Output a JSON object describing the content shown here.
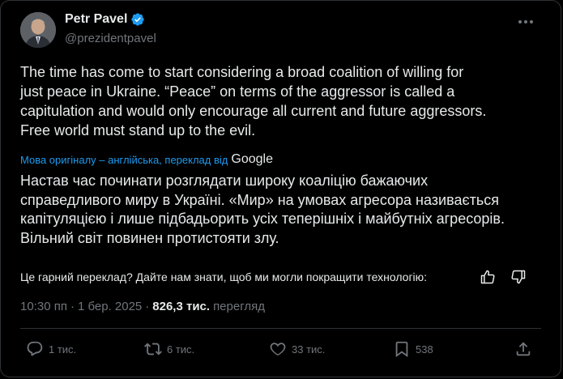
{
  "author": {
    "name": "Petr Pavel",
    "handle": "@prezidentpavel",
    "verified_color": "#1d9bf0"
  },
  "tweet": {
    "text_lines": [
      "The time has come to start considering a broad coalition of willing for",
      "just peace in Ukraine. “Peace” on terms of the aggressor is called a",
      "capitulation and would only encourage all current and future aggressors.",
      "Free world must stand up to the evil."
    ]
  },
  "translation": {
    "source_note": "Мова оригіналу – англійська, переклад від",
    "provider": "Google",
    "text_lines": [
      "Настав час починати розглядати широку коаліцію бажаючих",
      "справедливого миру в Україні. «Мир» на умовах агресора називається",
      "капітуляцією і лише підбадьорить усіх теперішніх і майбутніх агресорів.",
      "Вільний світ повинен протистояти злу."
    ],
    "feedback_question": "Це гарний переклад? Дайте нам знати, щоб ми могли покращити технологію:"
  },
  "meta": {
    "time": "10:30 пп",
    "separator": "·",
    "date": "1 бер. 2025",
    "views_count": "826,3 тис.",
    "views_label": "перегляд"
  },
  "actions": {
    "replies": "1 тис.",
    "reposts": "6 тис.",
    "likes": "33 тис.",
    "bookmarks": "538"
  },
  "icons": [
    "more-icon",
    "verified-badge-icon",
    "thumbs-up-icon",
    "thumbs-down-icon",
    "reply-icon",
    "repost-icon",
    "like-icon",
    "bookmark-icon",
    "share-icon"
  ],
  "colors": {
    "background": "#000000",
    "text": "#e7e9ea",
    "muted": "#71767b",
    "link": "#1d9bf0",
    "border": "#2f3336"
  }
}
